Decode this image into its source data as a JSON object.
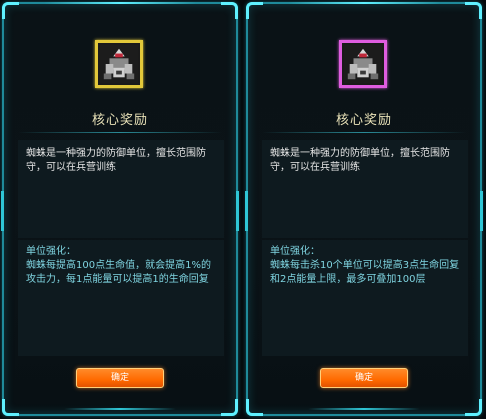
{
  "panels": [
    {
      "title": "核心奖励",
      "frame_color": "#e2c83a",
      "description": "蜘蛛是一种强力的防御单位，擅长范围防守，可以在兵营训练",
      "bonus_heading": "单位强化：",
      "bonus_text": "蜘蛛每提高100点生命值，就会提高1%的攻击力，每1点能量可以提高1的生命回复",
      "confirm_label": "确定"
    },
    {
      "title": "核心奖励",
      "frame_color": "#e05de0",
      "description": "蜘蛛是一种强力的防御单位，擅长范围防守，可以在兵营训练",
      "bonus_heading": "单位强化：",
      "bonus_text": "蜘蛛每击杀10个单位可以提高3点生命回复和2点能量上限，最多可叠加100层",
      "confirm_label": "确定"
    }
  ],
  "accent_color": "#2fc6d6",
  "button_color": "#ff6a00"
}
